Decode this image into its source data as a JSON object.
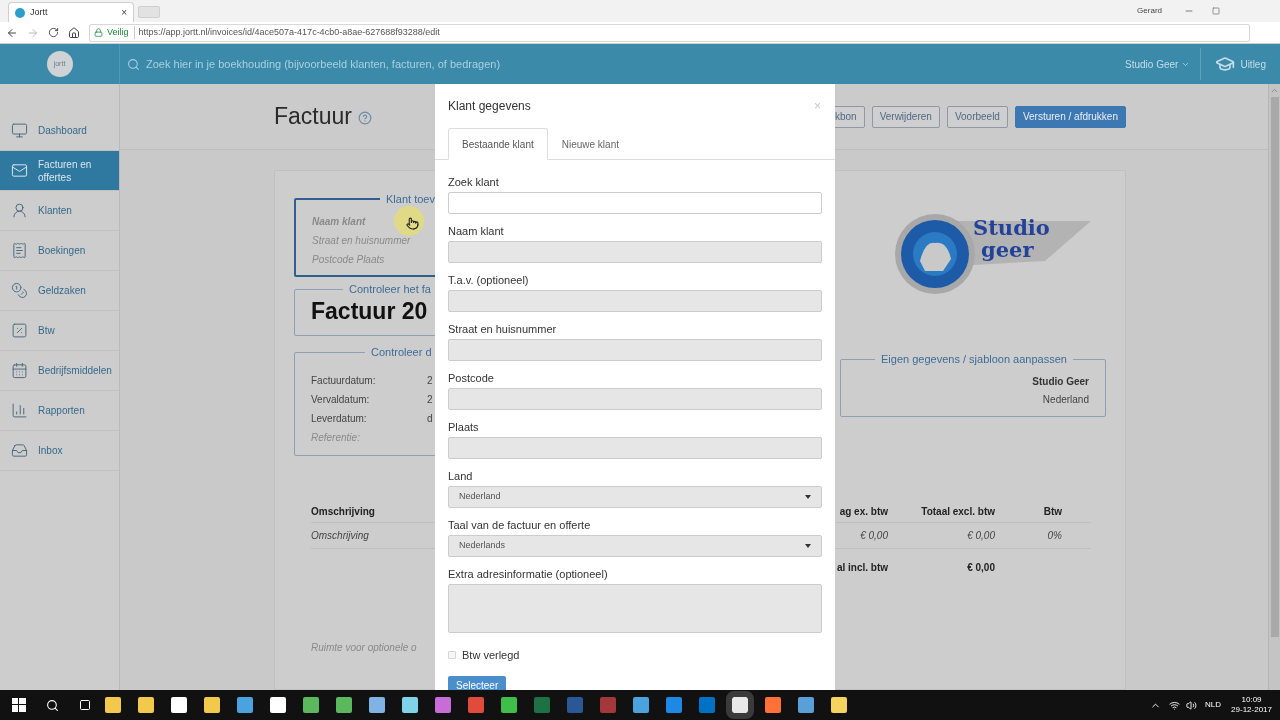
{
  "browser": {
    "tab_title": "Jortt",
    "tab_close": "×",
    "profile": "Gerard",
    "secure_label": "Veilig",
    "url": "https://app.jortt.nl/invoices/id/4ace507a-417c-4cb0-a8ae-627688f93288/edit"
  },
  "header": {
    "logo": "jortt",
    "search_placeholder": "Zoek hier in je boekhouding (bijvoorbeeld klanten, facturen, of bedragen)",
    "account": "Studio Geer",
    "help": "Uitleg"
  },
  "sidebar": {
    "items": [
      {
        "label": "Dashboard",
        "selected": false
      },
      {
        "label": "Facturen en offertes",
        "selected": true
      },
      {
        "label": "Klanten",
        "selected": false
      },
      {
        "label": "Boekingen",
        "selected": false
      },
      {
        "label": "Geldzaken",
        "selected": false
      },
      {
        "label": "Btw",
        "selected": false
      },
      {
        "label": "Bedrijfsmiddelen",
        "selected": false
      },
      {
        "label": "Rapporten",
        "selected": false
      },
      {
        "label": "Inbox",
        "selected": false
      }
    ]
  },
  "page": {
    "title": "Factuur",
    "actions": [
      {
        "label": "kbon",
        "primary": false
      },
      {
        "label": "Verwijderen",
        "primary": false
      },
      {
        "label": "Voorbeeld",
        "primary": false
      },
      {
        "label": "Versturen / afdrukken",
        "primary": true
      }
    ]
  },
  "invoice": {
    "client_box": {
      "legend": "Klant toev",
      "name_placeholder": "Naam klant",
      "street_placeholder": "Straat en huisnummer",
      "city_placeholder": "Postcode Plaats"
    },
    "number_box": {
      "legend": "Controleer het fa",
      "number": "Factuur 20"
    },
    "dates_box": {
      "legend": "Controleer d",
      "rows": [
        {
          "label": "Factuurdatum:",
          "value": "2"
        },
        {
          "label": "Vervaldatum:",
          "value": "2"
        },
        {
          "label": "Leverdatum:",
          "value": "d"
        }
      ],
      "reference_placeholder": "Referentie:"
    },
    "logo": {
      "line1": "Studio",
      "line2": "geer"
    },
    "own_box": {
      "legend": "Eigen gegevens / sjabloon aanpassen",
      "name": "Studio Geer",
      "country": "Nederland"
    },
    "table": {
      "columns": [
        "Omschrijving",
        "ag ex. btw",
        "Totaal excl. btw",
        "Btw"
      ],
      "rows": [
        [
          "Omschrijving",
          "€ 0,00",
          "€ 0,00",
          "0%"
        ]
      ],
      "total_label": "al incl. btw",
      "total_value": "€ 0,00"
    },
    "notes_placeholder": "Ruimte voor optionele o"
  },
  "modal": {
    "title": "Klant gegevens",
    "close": "×",
    "tabs": [
      {
        "label": "Bestaande klant",
        "selected": true
      },
      {
        "label": "Nieuwe klant",
        "selected": false
      }
    ],
    "fields": [
      {
        "kind": "text",
        "label": "Zoek klant",
        "readonly": false
      },
      {
        "kind": "text",
        "label": "Naam klant",
        "readonly": true
      },
      {
        "kind": "text",
        "label": "T.a.v. (optioneel)",
        "readonly": true
      },
      {
        "kind": "text",
        "label": "Straat en huisnummer",
        "readonly": true
      },
      {
        "kind": "text",
        "label": "Postcode",
        "readonly": true
      },
      {
        "kind": "text",
        "label": "Plaats",
        "readonly": true
      },
      {
        "kind": "select",
        "label": "Land",
        "value": "Nederland",
        "readonly": true
      },
      {
        "kind": "select",
        "label": "Taal van de factuur en offerte",
        "value": "Nederlands",
        "readonly": true
      },
      {
        "kind": "textarea",
        "label": "Extra adresinformatie (optioneel)",
        "readonly": true
      }
    ],
    "checkbox": {
      "label": "Btw verlegd",
      "checked": false
    },
    "submit": "Selecteer"
  },
  "taskbar": {
    "language": "NLD",
    "time": "10:09",
    "date": "29-12-2017"
  }
}
